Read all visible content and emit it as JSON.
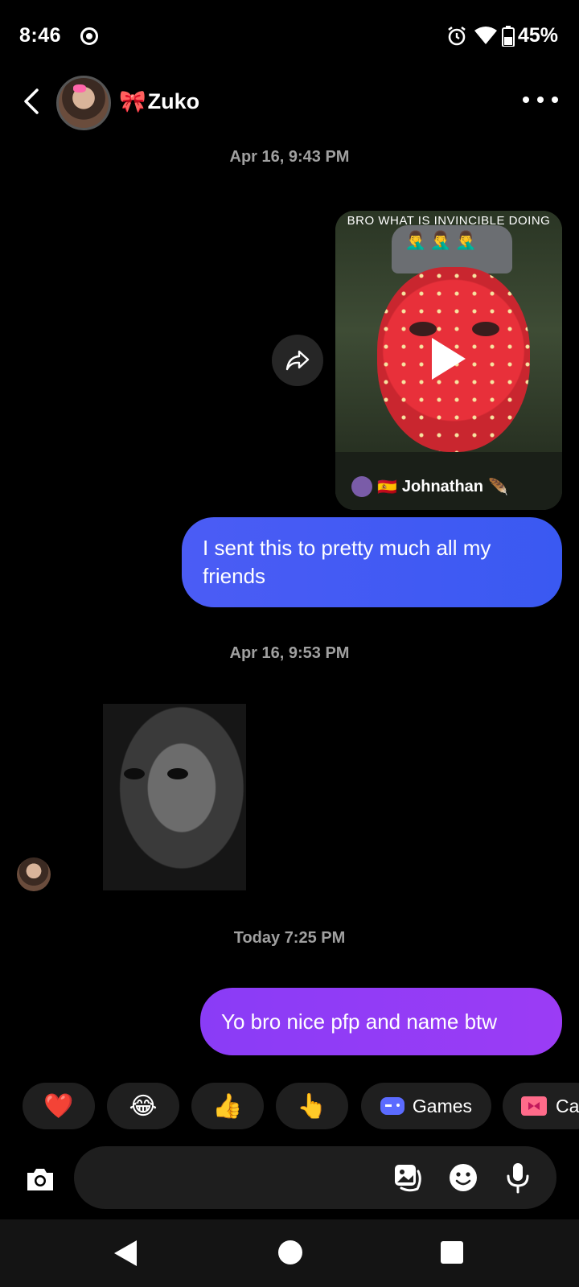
{
  "status_bar": {
    "time": "8:46",
    "battery": "45%"
  },
  "header": {
    "contact_name": "Zuko",
    "contact_emoji": "🎀"
  },
  "messages": {
    "timestamp_1": "Apr 16, 9:43 PM",
    "video": {
      "overlay_text": "BRO WHAT IS INVINCIBLE DOING",
      "overlay_emojis": "🤦‍♂️🤦‍♂️🤦‍♂️",
      "author_flag": "🇪🇸",
      "author": "Johnathan",
      "author_suffix": "🪶"
    },
    "sent_1": "I sent this to pretty much all my friends",
    "timestamp_2": "Apr 16, 9:53 PM",
    "timestamp_3": "Today 7:25 PM",
    "sent_2": "Yo bro nice pfp and name btw"
  },
  "quick_replies": {
    "heart": "❤️",
    "laugh": "😂",
    "thumbs": "👍",
    "point": "👆",
    "games": "Games",
    "cam": "Ca"
  },
  "composer": {
    "placeholder": ""
  },
  "colors": {
    "sent_blue": "#3a59f2",
    "sent_purple": "#9b3cf5",
    "chip_bg": "#1f1f1f"
  }
}
